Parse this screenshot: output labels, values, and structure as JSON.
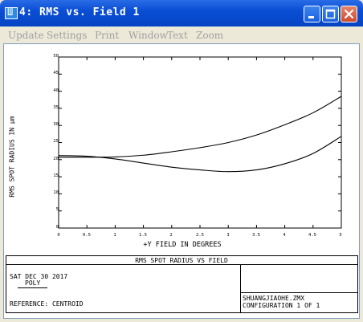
{
  "window": {
    "icon_glyph": "Ш",
    "title": "4: RMS vs. Field 1",
    "buttons": {
      "minimize": "minimize-icon",
      "maximize": "maximize-icon",
      "close": "close-icon"
    }
  },
  "menu": [
    "Update",
    "Settings",
    "Print",
    "Window",
    "Text",
    "Zoom"
  ],
  "chart_data": {
    "type": "line",
    "xlabel": "+Y FIELD IN DEGREES",
    "ylabel": "RMS SPOT RADIUS IN µm",
    "xlim": [
      0,
      5
    ],
    "ylim": [
      0,
      50
    ],
    "xticks": [
      "0",
      "0.5",
      "1",
      "1.5",
      "2",
      "2.5",
      "3",
      "3.5",
      "4",
      "4.5",
      "5"
    ],
    "yticks": [
      "50",
      "45",
      "40",
      "35",
      "30",
      "25",
      "20",
      "15",
      "10",
      "5",
      "0"
    ],
    "grid": false,
    "series": [
      {
        "x": [
          0,
          0.5,
          1,
          1.5,
          2,
          2.5,
          3,
          3.5,
          4,
          4.5,
          5
        ],
        "values": [
          20.7,
          20.7,
          20.8,
          21.3,
          22.3,
          23.5,
          25.0,
          27.2,
          30.2,
          33.7,
          38.5
        ]
      },
      {
        "x": [
          0,
          0.5,
          1,
          1.5,
          2,
          2.5,
          3,
          3.5,
          4,
          4.5,
          5
        ],
        "values": [
          21.2,
          21.0,
          20.2,
          19.0,
          17.8,
          17.0,
          16.5,
          17.0,
          18.8,
          21.8,
          26.8
        ]
      }
    ]
  },
  "caption": {
    "title": "RMS SPOT RADIUS VS FIELD",
    "date": "SAT DEC 30 2017",
    "label": "POLY",
    "reference": "REFERENCE: CENTROID",
    "filename": "SHUANGJIAOHE.ZMX",
    "configuration": "CONFIGURATION 1 OF 1"
  }
}
